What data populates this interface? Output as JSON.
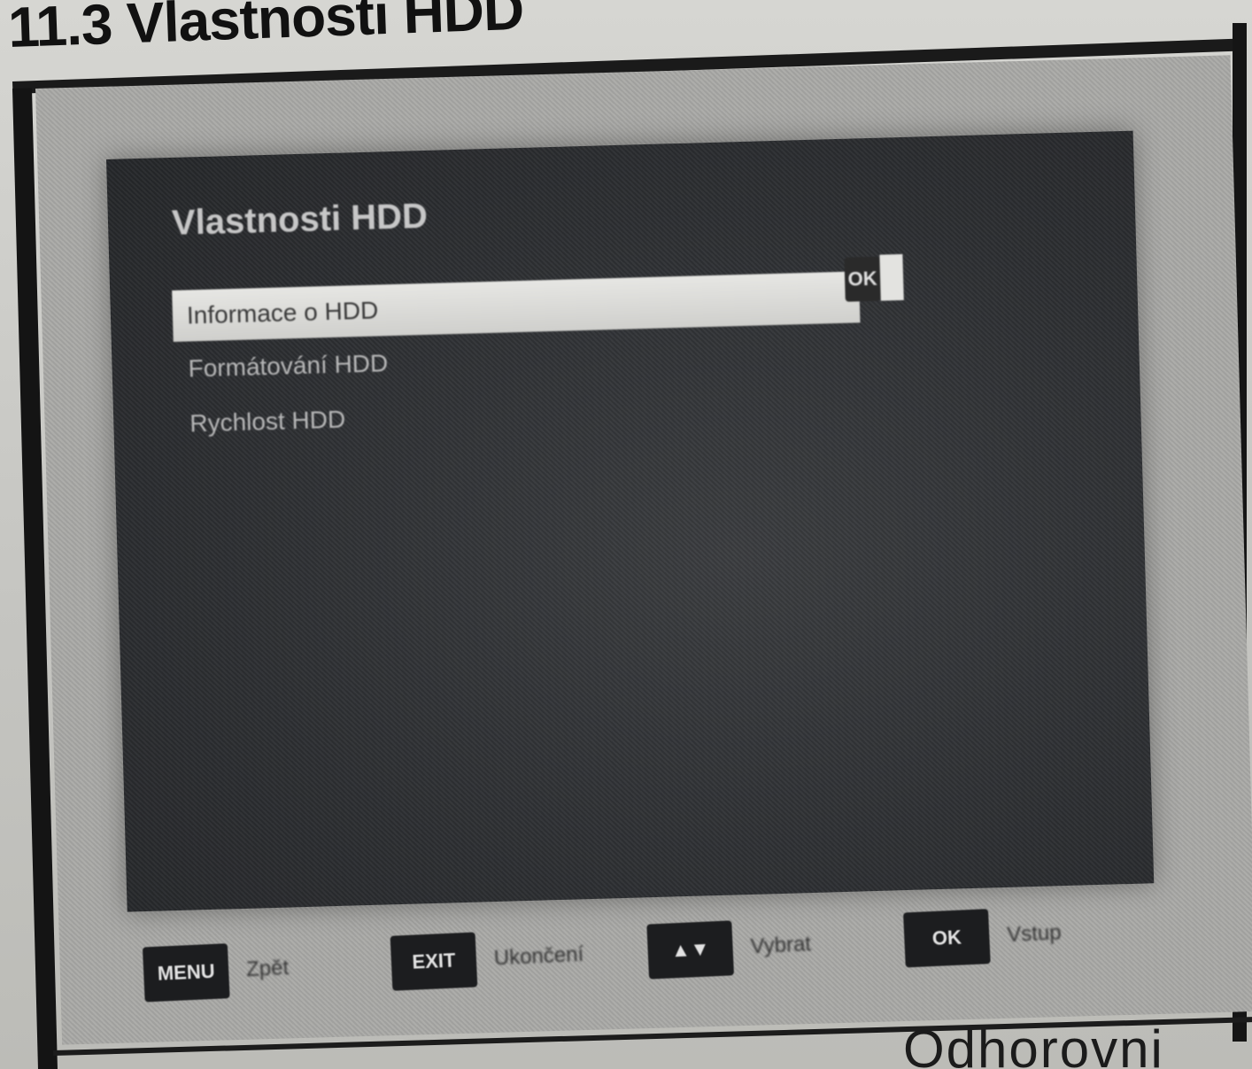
{
  "document": {
    "heading": "11.3 Vlastnosti HDD",
    "bottom_fragment": "Odhorovni"
  },
  "osd": {
    "title": "Vlastnosti HDD",
    "menu_items": [
      {
        "label": "Informace o HDD",
        "selected": true
      },
      {
        "label": "Formátování HDD",
        "selected": false
      },
      {
        "label": "Rychlost HDD",
        "selected": false
      }
    ],
    "ok_chip": "OK"
  },
  "legend": {
    "items": [
      {
        "key": "MENU",
        "label": "Zpět"
      },
      {
        "key": "EXIT",
        "label": "Ukončení"
      },
      {
        "key": "▲▼",
        "label": "Vybrat"
      },
      {
        "key": "OK",
        "label": "Vstup"
      }
    ]
  },
  "colors": {
    "osd_background": "#2d2f32",
    "selected_row": "#dcdcd9",
    "page_background": "#c9c9c5"
  }
}
